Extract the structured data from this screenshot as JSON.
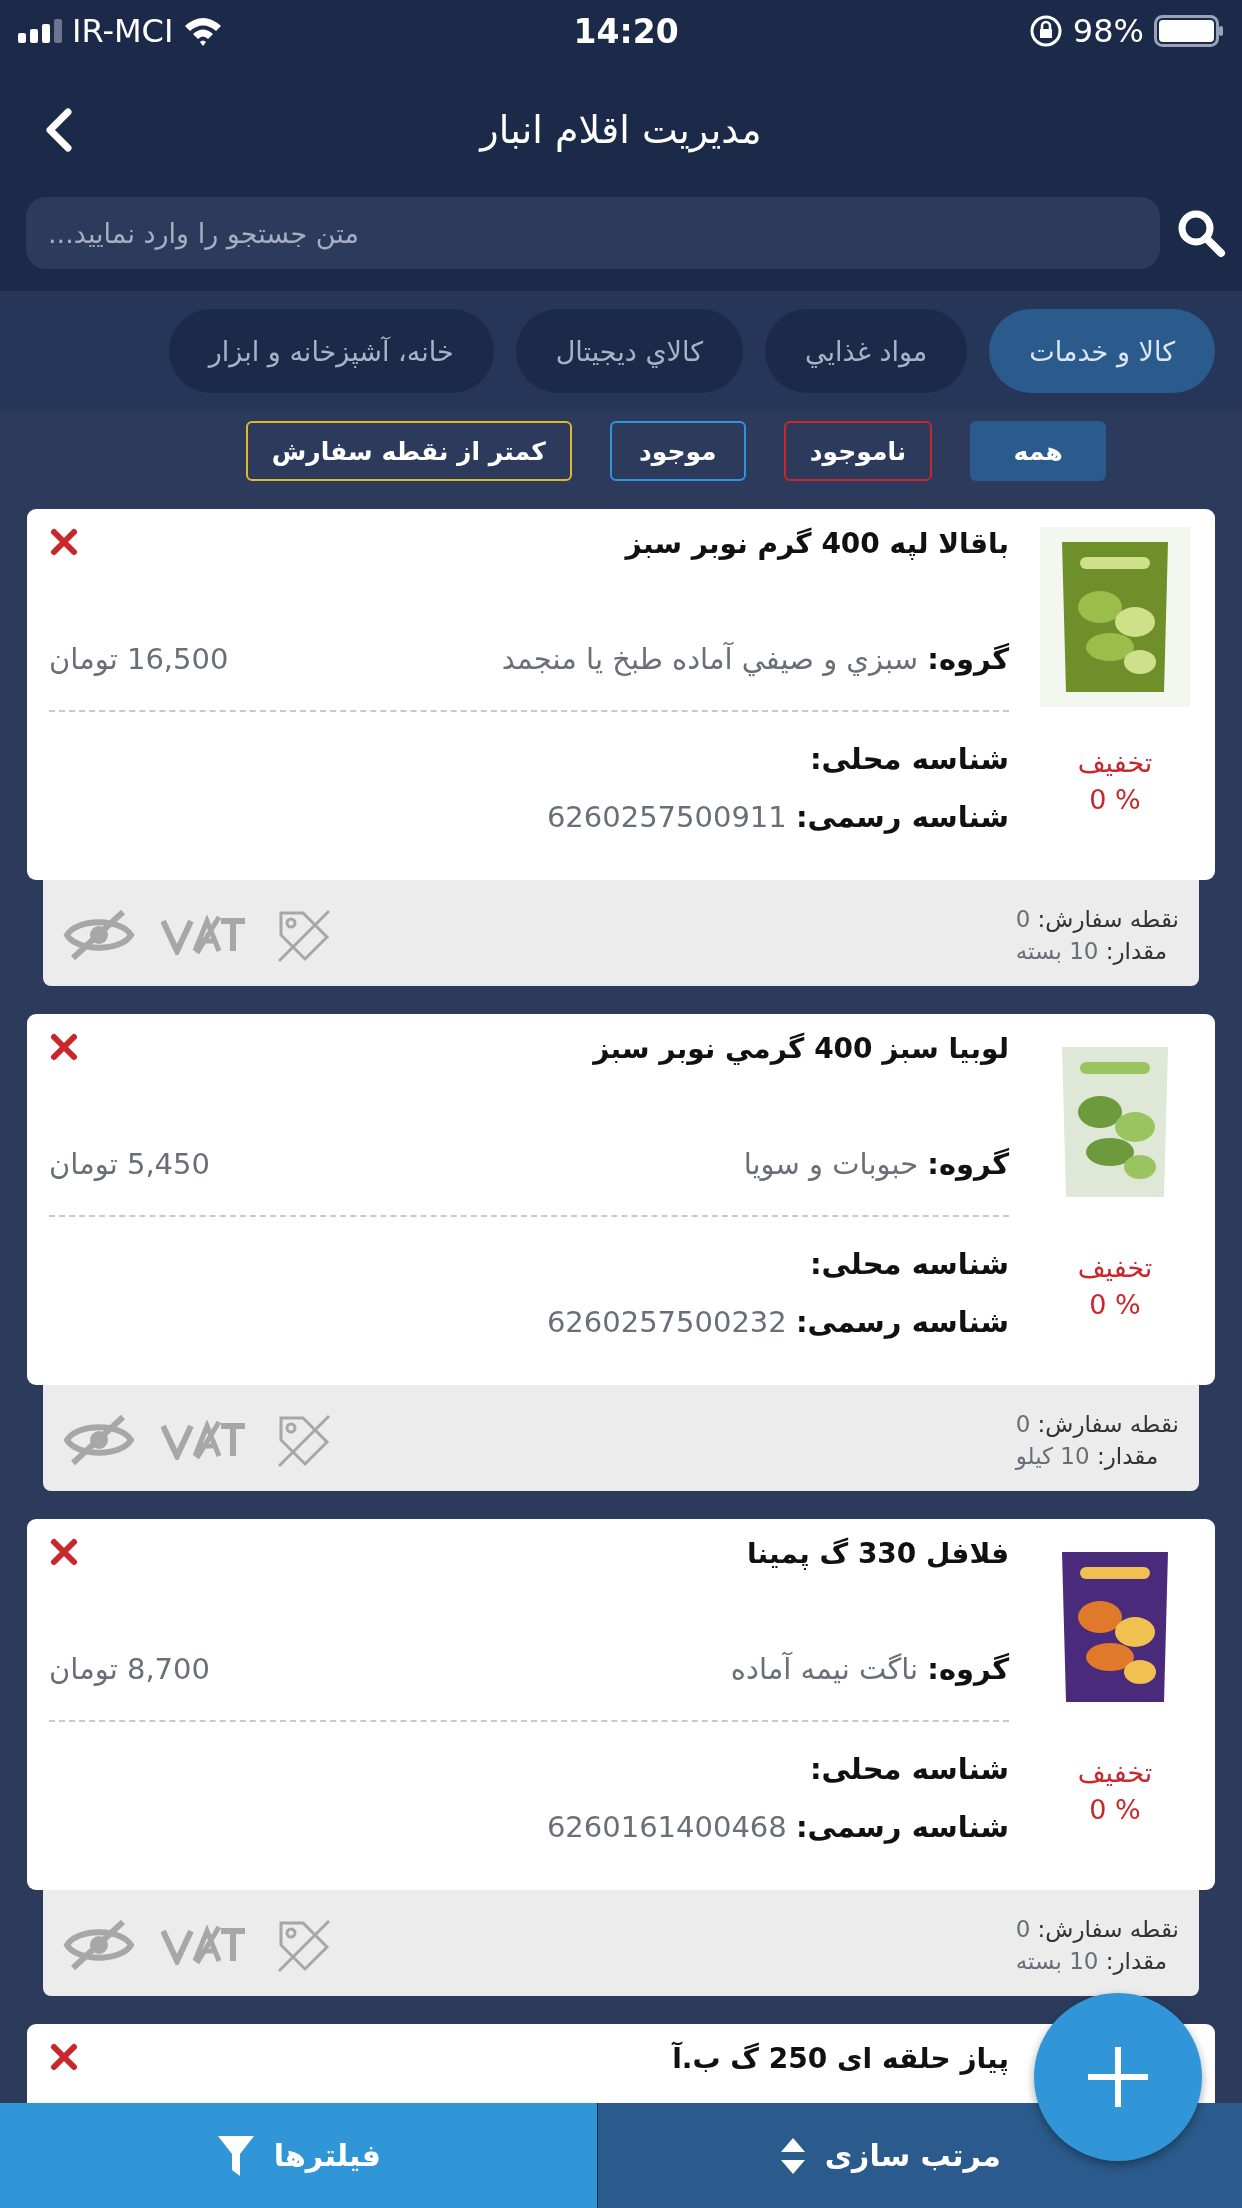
{
  "status_bar": {
    "carrier": "IR-MCI",
    "time": "14:20",
    "battery": "98%"
  },
  "header": {
    "title": "مدیریت اقلام انبار"
  },
  "search": {
    "placeholder": "متن جستجو را وارد نمایید..."
  },
  "categories": [
    {
      "label": "کالا و خدمات",
      "selected": true
    },
    {
      "label": "مواد غذايي",
      "selected": false
    },
    {
      "label": "كالاي ديجيتال",
      "selected": false
    },
    {
      "label": "خانه، آشپزخانه و ابزار",
      "selected": false
    }
  ],
  "filters": [
    {
      "label": "همه",
      "selected": true,
      "color": "#2b5b8c"
    },
    {
      "label": "ناموجود",
      "selected": false,
      "color": "#c8272b"
    },
    {
      "label": "موجود",
      "selected": false,
      "color": "#2f95da"
    },
    {
      "label": "کمتر از نقطه سفارش",
      "selected": false,
      "color": "#e0b82a"
    }
  ],
  "products": [
    {
      "kind": "full",
      "name": "باقالا لپه 400 گرم نوبر سبز",
      "group_label": "گروه:",
      "group": "سبزي و صيفي آماده طبخ يا منجمد",
      "price": "16,500 تومان",
      "local_id_label": "شناسه محلی:",
      "official_id_label": "شناسه رسمی:",
      "official_id": "6260257500911",
      "discount_label": "تخفیف",
      "discount": "0 %",
      "order_point_label": "نقطه سفارش:",
      "order_point": "0",
      "quantity_label": "مقدار:",
      "quantity": "10 بسته",
      "visible": false,
      "vat": false,
      "tagged": false
    },
    {
      "kind": "full",
      "name": "لوبيا سبز 400 گرمي نوبر سبز",
      "group_label": "گروه:",
      "group": "حبوبات و سويا",
      "price": "5,450 تومان",
      "local_id_label": "شناسه محلی:",
      "official_id_label": "شناسه رسمی:",
      "official_id": "6260257500232",
      "discount_label": "تخفیف",
      "discount": "0 %",
      "order_point_label": "نقطه سفارش:",
      "order_point": "0",
      "quantity_label": "مقدار:",
      "quantity": "10 کیلو",
      "visible": false,
      "vat": false,
      "tagged": false
    },
    {
      "kind": "full",
      "name": "فلافل 330 گ پمينا",
      "group_label": "گروه:",
      "group": "ناگت نيمه آماده",
      "price": "8,700 تومان",
      "local_id_label": "شناسه محلی:",
      "official_id_label": "شناسه رسمی:",
      "official_id": "6260161400468",
      "discount_label": "تخفیف",
      "discount": "0 %",
      "order_point_label": "نقطه سفارش:",
      "order_point": "0",
      "quantity_label": "مقدار:",
      "quantity": "10 بسته",
      "visible": false,
      "vat": false,
      "tagged": false
    },
    {
      "kind": "cut",
      "name": "پیاز حلقه ای 250 گ ب.آ"
    }
  ],
  "bottom_bar": {
    "filters": "فیلترها",
    "sort": "مرتب سازی"
  }
}
